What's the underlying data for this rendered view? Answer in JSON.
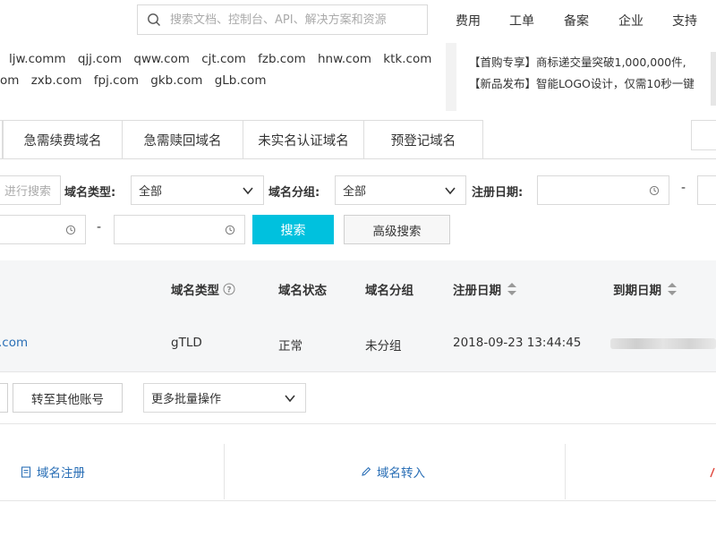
{
  "header": {
    "search_placeholder": "搜索文档、控制台、API、解决方案和资源",
    "nav": [
      "费用",
      "工单",
      "备案",
      "企业",
      "支持"
    ]
  },
  "banner": {
    "domains_line1": [
      "ljw.comm",
      "qjj.com",
      "qww.com",
      "cjt.com",
      "fzb.com",
      "hnw.com",
      "ktk.com"
    ],
    "domains_line2": [
      "om",
      "zxb.com",
      "fpj.com",
      "gkb.com",
      "gLb.com"
    ],
    "news": [
      "【首购专享】商标递交量突破1,000,000件,",
      "【新品发布】智能LOGO设计，仅需10秒一键"
    ]
  },
  "tabs": [
    "急需续费域名",
    "急需赎回域名",
    "未实名认证域名",
    "预登记域名"
  ],
  "filters": {
    "search_partial": "进行搜索",
    "type_label": "域名类型:",
    "type_value": "全部",
    "group_label": "域名分组:",
    "group_value": "全部",
    "reg_date_label": "注册日期:",
    "dash": "-",
    "search_btn": "搜索",
    "advanced_btn": "高级搜索"
  },
  "table": {
    "headers": [
      "域名类型",
      "域名状态",
      "域名分组",
      "注册日期",
      "到期日期"
    ],
    "row": {
      "domain_partial": ".com",
      "type": "gTLD",
      "status": "正常",
      "group": "未分组",
      "reg_date": "2018-09-23 13:44:45"
    }
  },
  "batch": {
    "transfer_btn": "转至其他账号",
    "more_select": "更多批量操作"
  },
  "footer_actions": {
    "register": "域名注册",
    "transfer_in": "域名转入"
  },
  "colors": {
    "primary": "#00c1de",
    "link": "#2a6fb6"
  }
}
